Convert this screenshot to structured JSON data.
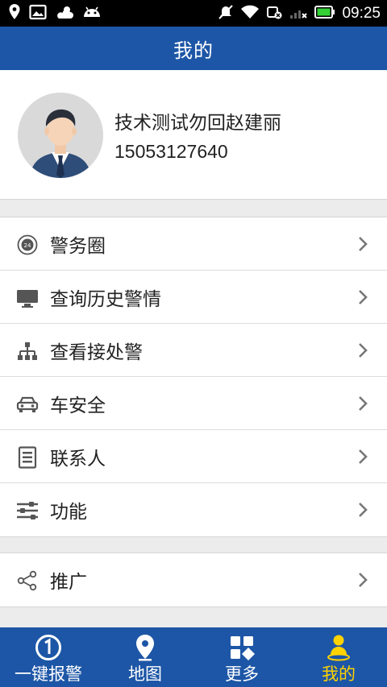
{
  "status_bar": {
    "time": "09:25",
    "left_icons": [
      "location-icon",
      "image-icon",
      "weather-icon",
      "android-icon"
    ],
    "right_icons": [
      "mute-icon",
      "wifi-icon",
      "data-off-icon",
      "signal-icon",
      "battery-icon"
    ]
  },
  "header": {
    "title": "我的"
  },
  "profile": {
    "name": "技术测试勿回赵建丽",
    "phone": "15053127640"
  },
  "menu": {
    "group1": [
      {
        "label": "警务圈",
        "icon": "police-circle-icon"
      },
      {
        "label": "查询历史警情",
        "icon": "monitor-icon"
      },
      {
        "label": "查看接处警",
        "icon": "hierarchy-icon"
      },
      {
        "label": "车安全",
        "icon": "car-icon"
      },
      {
        "label": "联系人",
        "icon": "contacts-icon"
      },
      {
        "label": "功能",
        "icon": "settings-sliders-icon"
      }
    ],
    "group2": [
      {
        "label": "推广",
        "icon": "share-icon"
      }
    ]
  },
  "bottom_nav": {
    "tabs": [
      {
        "label": "一键报警",
        "icon": "emergency-icon"
      },
      {
        "label": "地图",
        "icon": "map-pin-icon"
      },
      {
        "label": "更多",
        "icon": "grid-icon"
      },
      {
        "label": "我的",
        "icon": "user-icon"
      }
    ],
    "active_index": 3,
    "active_color": "#ffd200"
  },
  "colors": {
    "primary": "#1d56a6",
    "background": "#ececec"
  }
}
